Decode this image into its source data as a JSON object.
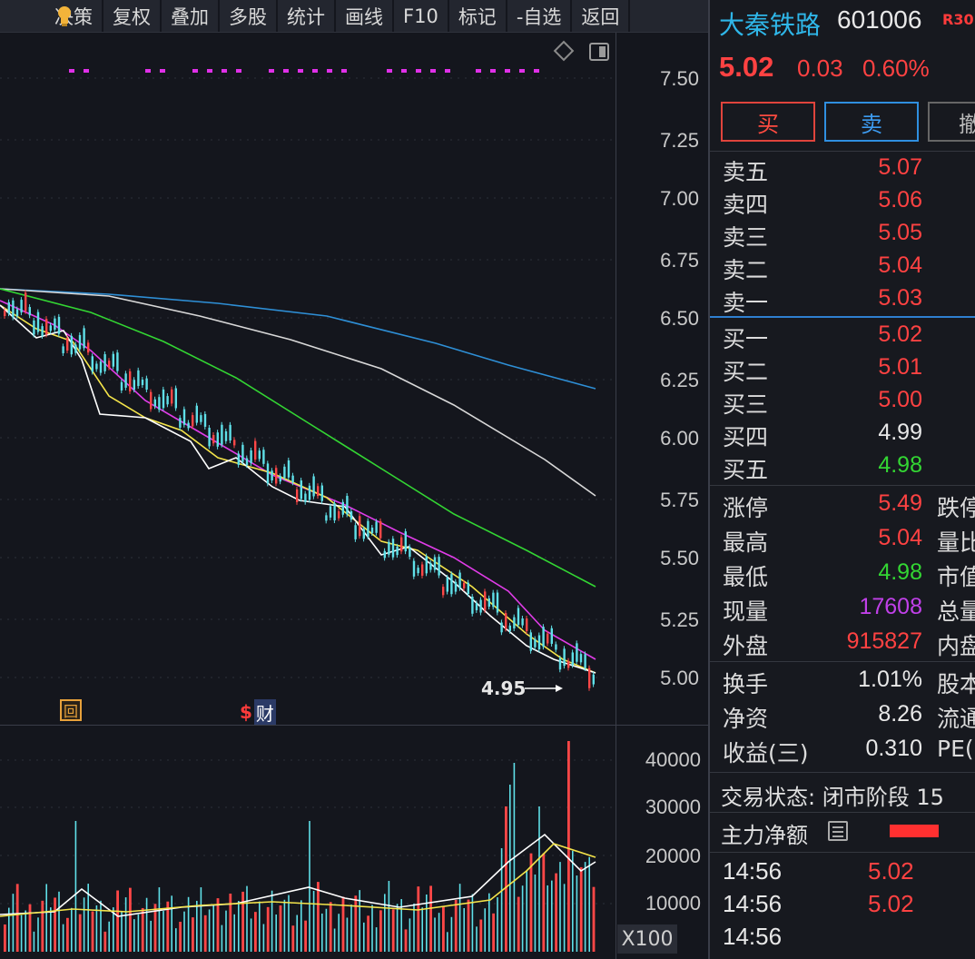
{
  "toolbar": {
    "items": [
      "决策",
      "复权",
      "叠加",
      "多股",
      "统计",
      "画线",
      "F10",
      "标记",
      "-自选",
      "返回"
    ]
  },
  "chart": {
    "price_ticks": [
      "7.50",
      "7.25",
      "7.00",
      "6.75",
      "6.50",
      "6.25",
      "6.00",
      "5.75",
      "5.50",
      "5.25",
      "5.00"
    ],
    "volume_ticks": [
      "40000",
      "30000",
      "20000",
      "10000"
    ],
    "volume_unit": "X100",
    "low_marker": "4.95",
    "event_hui": "回",
    "event_cai_s": "$",
    "event_cai": "财",
    "ma_colors": {
      "ma5": "#ffffff",
      "ma10": "#f4e44a",
      "ma20": "#e03ce8",
      "ma60": "#33d633",
      "ma120": "#d8d8d8",
      "ma250": "#2e8fd6"
    }
  },
  "quote": {
    "name": "大秦铁路",
    "code": "601006",
    "badge": "R30",
    "price": "5.02",
    "change": "0.03",
    "pct": "0.60%",
    "buy_label": "买",
    "sell_label": "卖",
    "cancel_label": "撤"
  },
  "orderbook": {
    "asks": [
      {
        "label": "卖五",
        "price": "5.07",
        "color": "#ff4242"
      },
      {
        "label": "卖四",
        "price": "5.06",
        "color": "#ff4242"
      },
      {
        "label": "卖三",
        "price": "5.05",
        "color": "#ff4242"
      },
      {
        "label": "卖二",
        "price": "5.04",
        "color": "#ff4242"
      },
      {
        "label": "卖一",
        "price": "5.03",
        "color": "#ff4242"
      }
    ],
    "bids": [
      {
        "label": "买一",
        "price": "5.02",
        "color": "#ff4242"
      },
      {
        "label": "买二",
        "price": "5.01",
        "color": "#ff4242"
      },
      {
        "label": "买三",
        "price": "5.00",
        "color": "#ff4242"
      },
      {
        "label": "买四",
        "price": "4.99",
        "color": "#e8e8e8"
      },
      {
        "label": "买五",
        "price": "4.98",
        "color": "#33d633"
      }
    ]
  },
  "stats": [
    {
      "label": "涨停",
      "value": "5.49",
      "color": "#ff4242",
      "label2": "跌停"
    },
    {
      "label": "最高",
      "value": "5.04",
      "color": "#ff4242",
      "label2": "量比"
    },
    {
      "label": "最低",
      "value": "4.98",
      "color": "#33d633",
      "label2": "市值"
    },
    {
      "label": "现量",
      "value": "17608",
      "color": "#c040e8",
      "label2": "总量"
    },
    {
      "label": "外盘",
      "value": "915827",
      "color": "#ff4242",
      "label2": "内盘"
    },
    {
      "label": "换手",
      "value": "1.01%",
      "color": "#e8e8e8",
      "label2": "股本"
    },
    {
      "label": "净资",
      "value": "8.26",
      "color": "#e8e8e8",
      "label2": "流通"
    },
    {
      "label": "收益(三)",
      "value": "0.310",
      "color": "#e8e8e8",
      "label2": "PE("
    }
  ],
  "status": {
    "trade_state": "交易状态: 闭市阶段 15",
    "main_net": "主力净额"
  },
  "ticks": [
    {
      "time": "14:56",
      "price": "5.02"
    },
    {
      "time": "14:56",
      "price": "5.02"
    },
    {
      "time": "14:56",
      "price": ""
    }
  ]
}
